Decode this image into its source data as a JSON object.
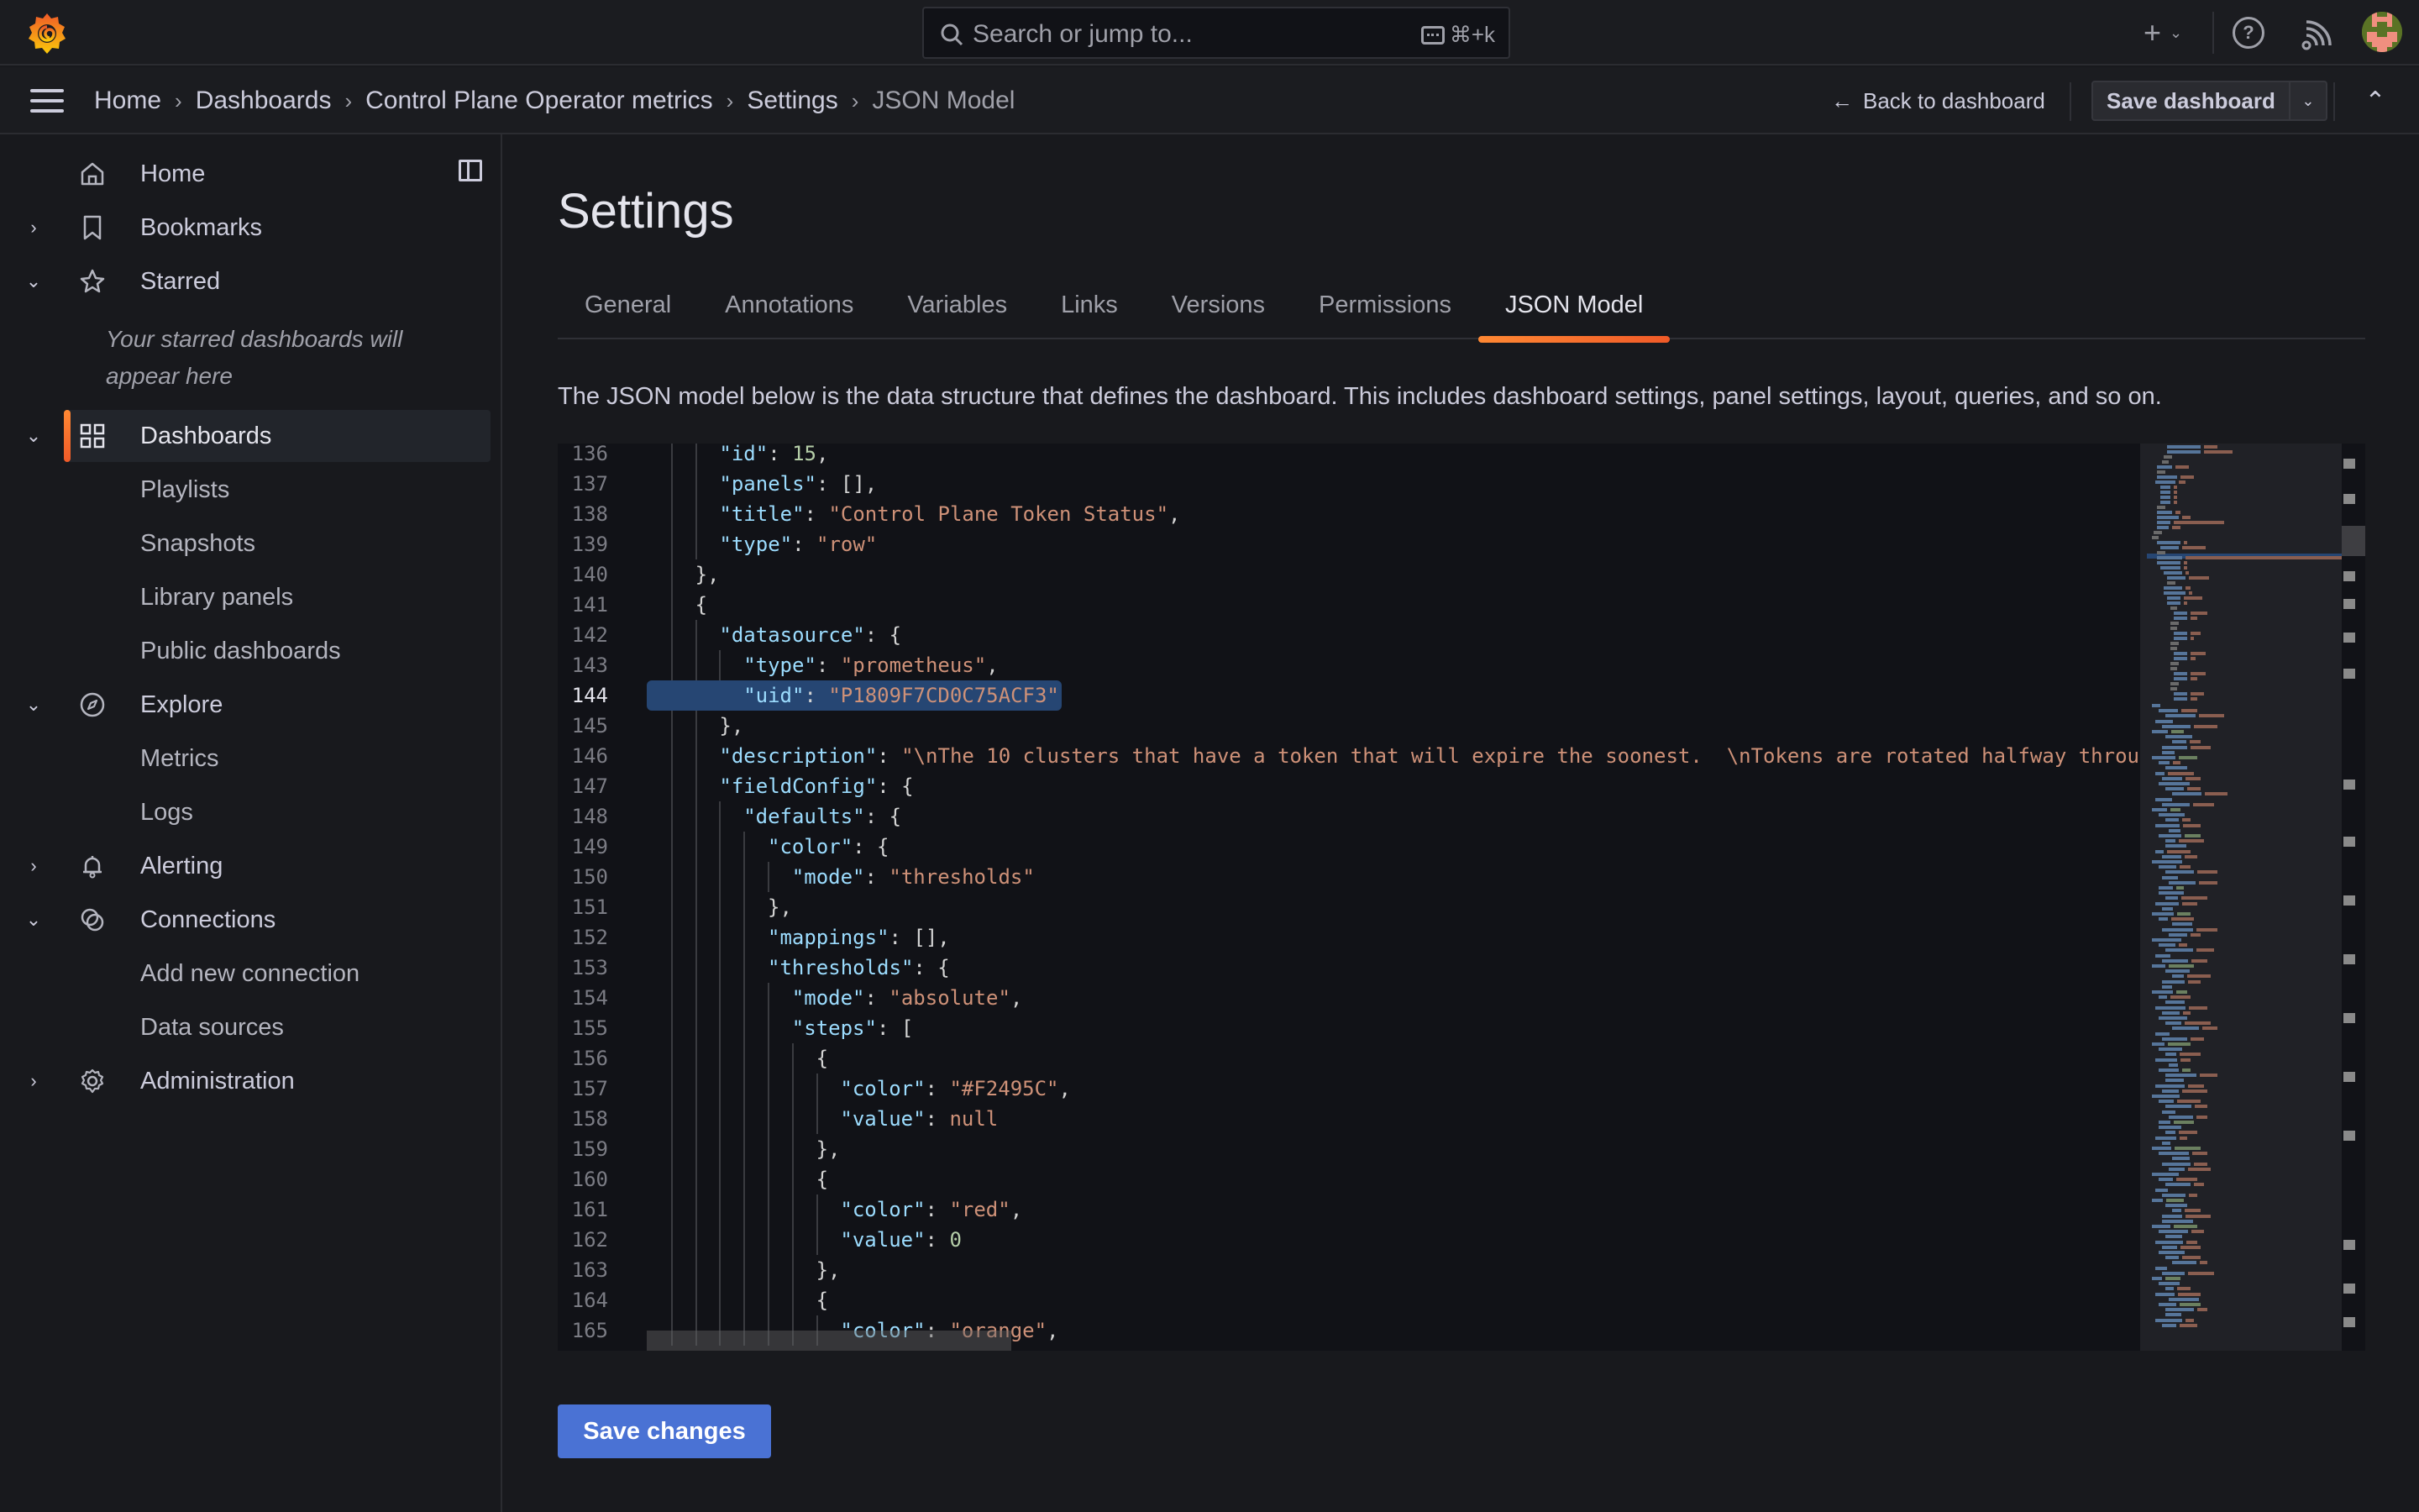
{
  "topbar": {
    "search_placeholder": "Search or jump to...",
    "search_shortcut": "⌘+k",
    "add_label": "+",
    "help_icon_label": "?"
  },
  "breadcrumb": [
    {
      "label": "Home"
    },
    {
      "label": "Dashboards"
    },
    {
      "label": "Control Plane Operator metrics"
    },
    {
      "label": "Settings"
    },
    {
      "label": "JSON Model"
    }
  ],
  "navbar": {
    "back_label": "Back to dashboard",
    "save_dashboard_label": "Save dashboard"
  },
  "sidebar": {
    "items": [
      {
        "label": "Home",
        "icon": "home-icon",
        "expander": "none"
      },
      {
        "label": "Bookmarks",
        "icon": "bookmark-icon",
        "expander": "collapsed"
      },
      {
        "label": "Starred",
        "icon": "star-icon",
        "expander": "expanded"
      },
      {
        "label": "Dashboards",
        "icon": "apps-icon",
        "expander": "expanded",
        "active": true
      },
      {
        "label": "Playlists"
      },
      {
        "label": "Snapshots"
      },
      {
        "label": "Library panels"
      },
      {
        "label": "Public dashboards"
      },
      {
        "label": "Explore",
        "icon": "compass-icon",
        "expander": "expanded"
      },
      {
        "label": "Metrics"
      },
      {
        "label": "Logs"
      },
      {
        "label": "Alerting",
        "icon": "bell-icon",
        "expander": "collapsed"
      },
      {
        "label": "Connections",
        "icon": "link-icon",
        "expander": "expanded"
      },
      {
        "label": "Add new connection"
      },
      {
        "label": "Data sources"
      },
      {
        "label": "Administration",
        "icon": "gear-icon",
        "expander": "collapsed"
      }
    ],
    "starred_empty": "Your starred dashboards will appear here"
  },
  "main": {
    "title": "Settings",
    "tabs": [
      {
        "label": "General"
      },
      {
        "label": "Annotations"
      },
      {
        "label": "Variables"
      },
      {
        "label": "Links"
      },
      {
        "label": "Versions"
      },
      {
        "label": "Permissions"
      },
      {
        "label": "JSON Model",
        "active": true
      }
    ],
    "description": "The JSON model below is the data structure that defines the dashboard. This includes dashboard settings, panel settings, layout, queries, and so on.",
    "save_changes_label": "Save changes"
  },
  "editor": {
    "current_line": 144,
    "lines": [
      {
        "n": 136,
        "indent": 3,
        "tokens": [
          [
            "k",
            "\"id\""
          ],
          [
            "p",
            ": "
          ],
          [
            "n",
            "15"
          ],
          [
            "p",
            ","
          ]
        ]
      },
      {
        "n": 137,
        "indent": 3,
        "tokens": [
          [
            "k",
            "\"panels\""
          ],
          [
            "p",
            ": [],"
          ]
        ]
      },
      {
        "n": 138,
        "indent": 3,
        "tokens": [
          [
            "k",
            "\"title\""
          ],
          [
            "p",
            ": "
          ],
          [
            "s",
            "\"Control Plane Token Status\""
          ],
          [
            "p",
            ","
          ]
        ]
      },
      {
        "n": 139,
        "indent": 3,
        "tokens": [
          [
            "k",
            "\"type\""
          ],
          [
            "p",
            ": "
          ],
          [
            "s",
            "\"row\""
          ]
        ]
      },
      {
        "n": 140,
        "indent": 2,
        "tokens": [
          [
            "p",
            "},"
          ]
        ]
      },
      {
        "n": 141,
        "indent": 2,
        "tokens": [
          [
            "p",
            "{"
          ]
        ]
      },
      {
        "n": 142,
        "indent": 3,
        "tokens": [
          [
            "k",
            "\"datasource\""
          ],
          [
            "p",
            ": {"
          ]
        ]
      },
      {
        "n": 143,
        "indent": 4,
        "tokens": [
          [
            "k",
            "\"type\""
          ],
          [
            "p",
            ": "
          ],
          [
            "s",
            "\"prometheus\""
          ],
          [
            "p",
            ","
          ]
        ]
      },
      {
        "n": 144,
        "indent": 4,
        "tokens": [
          [
            "k",
            "\"uid\""
          ],
          [
            "p",
            ": "
          ],
          [
            "s",
            "\"P1809F7CD0C75ACF3\""
          ]
        ]
      },
      {
        "n": 145,
        "indent": 3,
        "tokens": [
          [
            "p",
            "},"
          ]
        ]
      },
      {
        "n": 146,
        "indent": 3,
        "tokens": [
          [
            "k",
            "\"description\""
          ],
          [
            "p",
            ": "
          ],
          [
            "s",
            "\"\\nThe 10 clusters that have a token that will expire the soonest.  \\nTokens are rotated halfway throu"
          ]
        ]
      },
      {
        "n": 147,
        "indent": 3,
        "tokens": [
          [
            "k",
            "\"fieldConfig\""
          ],
          [
            "p",
            ": {"
          ]
        ]
      },
      {
        "n": 148,
        "indent": 4,
        "tokens": [
          [
            "k",
            "\"defaults\""
          ],
          [
            "p",
            ": {"
          ]
        ]
      },
      {
        "n": 149,
        "indent": 5,
        "tokens": [
          [
            "k",
            "\"color\""
          ],
          [
            "p",
            ": {"
          ]
        ]
      },
      {
        "n": 150,
        "indent": 6,
        "tokens": [
          [
            "k",
            "\"mode\""
          ],
          [
            "p",
            ": "
          ],
          [
            "s",
            "\"thresholds\""
          ]
        ]
      },
      {
        "n": 151,
        "indent": 5,
        "tokens": [
          [
            "p",
            "},"
          ]
        ]
      },
      {
        "n": 152,
        "indent": 5,
        "tokens": [
          [
            "k",
            "\"mappings\""
          ],
          [
            "p",
            ": [],"
          ]
        ]
      },
      {
        "n": 153,
        "indent": 5,
        "tokens": [
          [
            "k",
            "\"thresholds\""
          ],
          [
            "p",
            ": {"
          ]
        ]
      },
      {
        "n": 154,
        "indent": 6,
        "tokens": [
          [
            "k",
            "\"mode\""
          ],
          [
            "p",
            ": "
          ],
          [
            "s",
            "\"absolute\""
          ],
          [
            "p",
            ","
          ]
        ]
      },
      {
        "n": 155,
        "indent": 6,
        "tokens": [
          [
            "k",
            "\"steps\""
          ],
          [
            "p",
            ": ["
          ]
        ]
      },
      {
        "n": 156,
        "indent": 7,
        "tokens": [
          [
            "p",
            "{"
          ]
        ]
      },
      {
        "n": 157,
        "indent": 8,
        "tokens": [
          [
            "k",
            "\"color\""
          ],
          [
            "p",
            ": "
          ],
          [
            "s",
            "\"#F2495C\""
          ],
          [
            "p",
            ","
          ]
        ]
      },
      {
        "n": 158,
        "indent": 8,
        "tokens": [
          [
            "k",
            "\"value\""
          ],
          [
            "p",
            ": "
          ],
          [
            "s",
            "null"
          ]
        ]
      },
      {
        "n": 159,
        "indent": 7,
        "tokens": [
          [
            "p",
            "},"
          ]
        ]
      },
      {
        "n": 160,
        "indent": 7,
        "tokens": [
          [
            "p",
            "{"
          ]
        ]
      },
      {
        "n": 161,
        "indent": 8,
        "tokens": [
          [
            "k",
            "\"color\""
          ],
          [
            "p",
            ": "
          ],
          [
            "s",
            "\"red\""
          ],
          [
            "p",
            ","
          ]
        ]
      },
      {
        "n": 162,
        "indent": 8,
        "tokens": [
          [
            "k",
            "\"value\""
          ],
          [
            "p",
            ": "
          ],
          [
            "n",
            "0"
          ]
        ]
      },
      {
        "n": 163,
        "indent": 7,
        "tokens": [
          [
            "p",
            "},"
          ]
        ]
      },
      {
        "n": 164,
        "indent": 7,
        "tokens": [
          [
            "p",
            "{"
          ]
        ]
      },
      {
        "n": 165,
        "indent": 8,
        "tokens": [
          [
            "k",
            "\"color\""
          ],
          [
            "p",
            ": "
          ],
          [
            "s",
            "\"orange\""
          ],
          [
            "p",
            ","
          ]
        ]
      }
    ]
  },
  "colors": {
    "accent_orange": "#ff8833",
    "primary_button": "#4a72d4",
    "selection": "#264673"
  }
}
